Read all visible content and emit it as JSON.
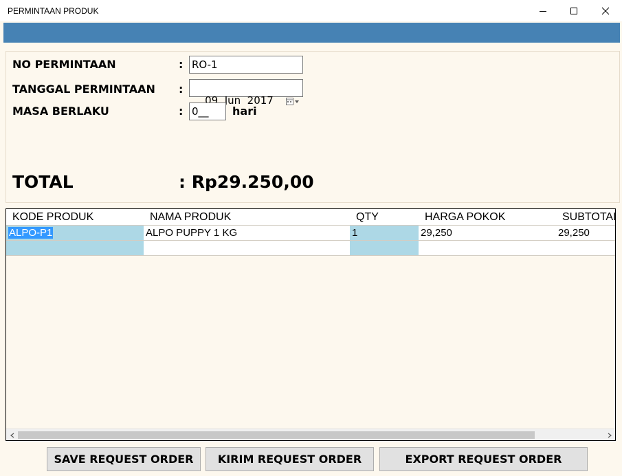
{
  "window": {
    "title": "PERMINTAAN PRODUK"
  },
  "form": {
    "no_permintaan": {
      "label": "NO PERMINTAAN",
      "value": "RO-1"
    },
    "tanggal_permintaan": {
      "label": "TANGGAL PERMINTAAN",
      "value": "09  Jun  2017"
    },
    "masa_berlaku": {
      "label": "MASA BERLAKU",
      "value": "0__",
      "unit": "hari"
    },
    "colon": ":",
    "total": {
      "label": "TOTAL",
      "value": ": Rp29.250,00"
    }
  },
  "grid": {
    "columns": [
      "KODE PRODUK",
      "NAMA PRODUK",
      "QTY",
      "HARGA POKOK",
      "SUBTOTAL"
    ],
    "rows": [
      [
        "ALPO-P1",
        "ALPO PUPPY 1 KG",
        "1",
        "29,250",
        "29,250"
      ],
      [
        "",
        "",
        "",
        "",
        ""
      ]
    ]
  },
  "buttons": {
    "save": "SAVE REQUEST ORDER",
    "kirim": "KIRIM REQUEST ORDER",
    "export": "EXPORT REQUEST ORDER"
  },
  "colors": {
    "accent_band": "#4682b4",
    "panel_bg": "#fdf8ee",
    "key_cell": "#add8e6",
    "selection": "#3399ff"
  },
  "icons": [
    "minimize-icon",
    "maximize-icon",
    "close-icon",
    "calendar-icon",
    "scroll-left-icon",
    "scroll-right-icon"
  ]
}
